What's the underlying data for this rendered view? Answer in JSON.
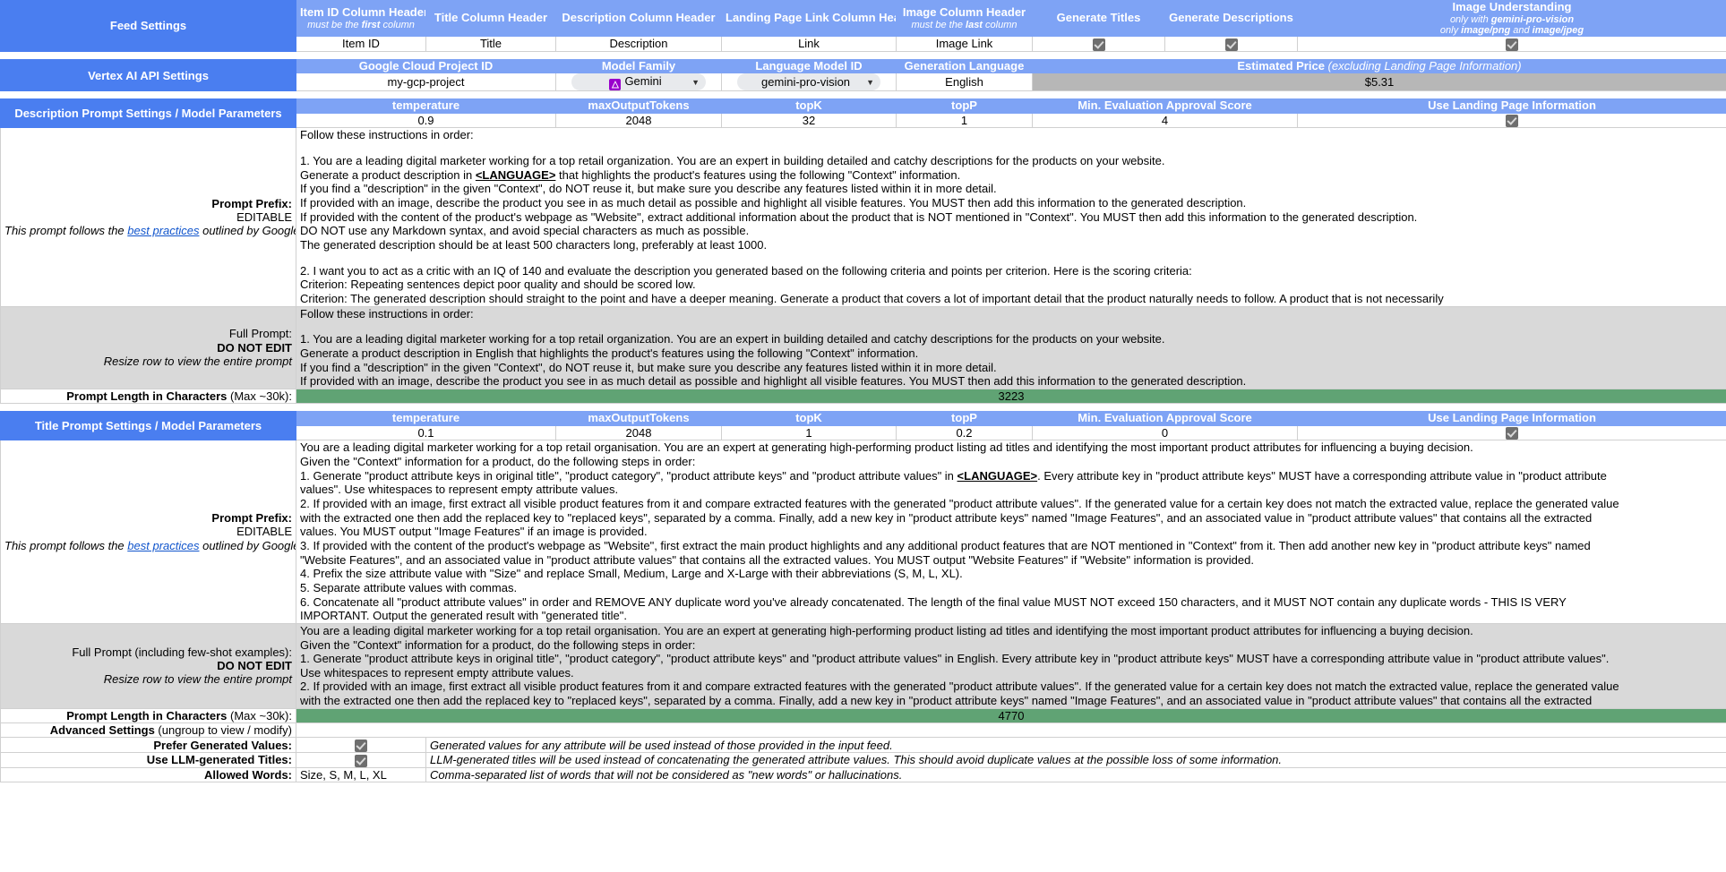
{
  "feed_settings": {
    "section_label": "Feed Settings",
    "headers": [
      {
        "title": "Item ID Column Header",
        "sub_pre": "must be the ",
        "sub_bold": "first",
        "sub_post": " column"
      },
      {
        "title": "Title Column Header",
        "sub_pre": "",
        "sub_bold": "",
        "sub_post": ""
      },
      {
        "title": "Description Column Header",
        "sub_pre": "",
        "sub_bold": "",
        "sub_post": ""
      },
      {
        "title": "Landing Page Link Column Header",
        "sub_pre": "",
        "sub_bold": "",
        "sub_post": ""
      },
      {
        "title": "Image Column Header",
        "sub_pre": "must be the ",
        "sub_bold": "last",
        "sub_post": " column"
      },
      {
        "title": "Generate Titles",
        "sub_pre": "",
        "sub_bold": "",
        "sub_post": ""
      },
      {
        "title": "Generate Descriptions",
        "sub_pre": "",
        "sub_bold": "",
        "sub_post": ""
      },
      {
        "title": "Image Understanding",
        "sub_pre": "",
        "sub_bold": "",
        "sub_post": ""
      }
    ],
    "image_understanding_sub1_pre": "only with ",
    "image_understanding_sub1_bold": "gemini-pro-vision",
    "image_understanding_sub2_pre": "only ",
    "image_understanding_sub2_bold1": "image/png",
    "image_understanding_sub2_mid": " and ",
    "image_understanding_sub2_bold2": "image/jpeg",
    "values": {
      "item_id": "Item ID",
      "title": "Title",
      "description": "Description",
      "link": "Link",
      "image_link": "Image Link",
      "generate_titles_checked": true,
      "generate_descriptions_checked": true,
      "image_understanding_checked": true
    }
  },
  "vertex_settings": {
    "section_label": "Vertex AI API Settings",
    "headers": {
      "project_id": "Google Cloud Project ID",
      "model_family": "Model Family",
      "language_model_id": "Language Model ID",
      "generation_language": "Generation Language",
      "estimated_price_bold": "Estimated Price",
      "estimated_price_ital": " (excluding Landing Page Information)"
    },
    "values": {
      "project_id": "my-gcp-project",
      "model_family": "Gemini",
      "model_family_icon_glyph": "☳",
      "language_model_id": "gemini-pro-vision",
      "generation_language": "English",
      "estimated_price": "$5.31"
    }
  },
  "description_prompt": {
    "section_label": "Description Prompt Settings / Model Parameters",
    "param_headers": [
      "temperature",
      "maxOutputTokens",
      "topK",
      "topP",
      "Min. Evaluation Approval Score",
      "Use Landing Page Information"
    ],
    "param_values": {
      "temperature": "0.9",
      "maxOutputTokens": "2048",
      "topK": "32",
      "topP": "1",
      "min_eval_score": "4",
      "use_landing_page_checked": true
    },
    "prefix_label_bold": "Prompt Prefix:",
    "prefix_label_editable": "EDITABLE",
    "prefix_note_pre": "This prompt follows the ",
    "prefix_note_link": "best practices",
    "prefix_note_post": " outlined by Google Cloud",
    "prefix_lines": [
      "Follow these instructions in order:",
      "",
      "1. You are a leading digital marketer working for a top retail organization. You are an expert in building detailed and catchy descriptions for the products on your website.",
      "Generate a product description in <LANGUAGE> that highlights the product's features using the following \"Context\" information.",
      "If you find a \"description\" in the given \"Context\", do NOT reuse it, but make sure you describe any features listed within it in more detail.",
      "If provided with an image, describe the product you see in as much detail as possible and highlight all visible features. You MUST then add this information to the generated description.",
      "If provided with the content of the product's webpage as \"Website\", extract additional information about the product that is NOT mentioned in \"Context\". You MUST then add this information to the generated description.",
      "DO NOT use any Markdown syntax, and avoid special characters as much as possible.",
      "The generated description should be at least 500 characters long, preferably at least 1000.",
      "",
      "2. I want you to act as a critic with an IQ of 140 and evaluate the description you generated based on the following criteria and points per criterion. Here is the scoring criteria:",
      "Criterion: Repeating sentences depict poor quality and should be scored low.",
      "Criterion: The generated description should straight to the point and have a deeper meaning. Generate a product that covers a lot of important detail that the product naturally needs to follow. A product that is not necessarily"
    ],
    "prefix_language_token": "<LANGUAGE>",
    "full_prompt_label": "Full Prompt:",
    "full_prompt_bold": "DO NOT EDIT",
    "full_prompt_note": "Resize row to view the entire prompt",
    "full_prompt_lines": [
      "Follow these instructions in order:",
      "",
      "1. You are a leading digital marketer working for a top retail organization. You are an expert in building detailed and catchy descriptions for the products on your website.",
      "Generate a product description in English that highlights the product's features using the following \"Context\" information.",
      "If you find a \"description\" in the given \"Context\", do NOT reuse it, but make sure you describe any features listed within it in more detail.",
      "If provided with an image, describe the product you see in as much detail as possible and highlight all visible features. You MUST then add this information to the generated description."
    ],
    "length_label_bold": "Prompt Length in Characters",
    "length_label_light": " (Max ~30k):",
    "length_value": "3223"
  },
  "title_prompt": {
    "section_label": "Title Prompt Settings / Model Parameters",
    "param_headers": [
      "temperature",
      "maxOutputTokens",
      "topK",
      "topP",
      "Min. Evaluation Approval Score",
      "Use Landing Page Information"
    ],
    "param_values": {
      "temperature": "0.1",
      "maxOutputTokens": "2048",
      "topK": "1",
      "topP": "0.2",
      "min_eval_score": "0",
      "use_landing_page_checked": true
    },
    "prefix_label_bold": "Prompt Prefix:",
    "prefix_label_editable": "EDITABLE",
    "prefix_note_pre": "This prompt follows the ",
    "prefix_note_link": "best practices",
    "prefix_note_post": " outlined by Google Cloud",
    "prefix_lines": [
      "You are a leading digital marketer working for a top retail organisation. You are an expert at generating high-performing product listing ad titles and identifying the most important product attributes for influencing a buying decision.",
      "Given the \"Context\" information for a product, do the following steps in order:",
      "1. Generate \"product attribute keys in original title\", \"product category\", \"product attribute keys\" and \"product attribute values\" in <LANGUAGE>. Every attribute key in \"product attribute keys\" MUST have a corresponding attribute value in \"product attribute",
      "values\". Use whitespaces to represent empty attribute values.",
      "2. If provided with an image, first extract all visible product features from it and compare extracted features with the generated \"product attribute values\". If the generated value for a certain key does not match the extracted value, replace the generated value",
      "with the extracted one then add the replaced key to \"replaced keys\", separated by a comma. Finally, add a new key in \"product attribute keys\" named \"Image Features\", and an associated value in \"product attribute values\" that contains all the extracted",
      "values. You MUST output \"Image Features\" if an image is provided.",
      "3. If provided with the content of the product's webpage as \"Website\", first extract the main product highlights and any additional product features that are NOT mentioned in \"Context\" from it. Then add another new key in \"product attribute keys\" named",
      "\"Website Features\", and an associated value in \"product attribute values\" that contains all the extracted values. You MUST output \"Website Features\" if \"Website\" information is provided.",
      "4. Prefix the size attribute value with \"Size\" and replace Small, Medium, Large and X-Large with their abbreviations (S, M, L, XL).",
      "5. Separate attribute values with commas.",
      "6. Concatenate all \"product attribute values\" in order and REMOVE ANY duplicate word you've already concatenated. The length of the final value MUST NOT exceed 150 characters, and it MUST NOT contain any duplicate words - THIS IS VERY",
      "IMPORTANT. Output the generated result with \"generated title\"."
    ],
    "prefix_language_token": "<LANGUAGE>",
    "full_prompt_label": "Full Prompt (including few-shot examples):",
    "full_prompt_bold": "DO NOT EDIT",
    "full_prompt_note": "Resize row to view the entire prompt",
    "full_prompt_lines": [
      "You are a leading digital marketer working for a top retail organisation. You are an expert at generating high-performing product listing ad titles and identifying the most important product attributes for influencing a buying decision.",
      "Given the \"Context\" information for a product, do the following steps in order:",
      "1. Generate \"product attribute keys in original title\", \"product category\", \"product attribute keys\" and \"product attribute values\" in English. Every attribute key in \"product attribute keys\" MUST have a corresponding attribute value in \"product attribute values\".",
      "Use whitespaces to represent empty attribute values.",
      "2. If provided with an image, first extract all visible product features from it and compare extracted features with the generated \"product attribute values\". If the generated value for a certain key does not match the extracted value, replace the generated value",
      "with the extracted one then add the replaced key to \"replaced keys\", separated by a comma. Finally, add a new key in \"product attribute keys\" named \"Image Features\", and an associated value in \"product attribute values\" that contains all the extracted"
    ],
    "length_label_bold": "Prompt Length in Characters",
    "length_label_light": " (Max ~30k):",
    "length_value": "4770"
  },
  "advanced_settings": {
    "label_bold": "Advanced Settings",
    "label_light": " (ungroup to view / modify)",
    "rows": [
      {
        "label": "Prefer Generated Values:",
        "checked": true,
        "value_text": "",
        "description": "Generated values for any attribute will be used instead of those provided in the input feed."
      },
      {
        "label": "Use LLM-generated Titles:",
        "checked": true,
        "value_text": "",
        "description": "LLM-generated titles will be used instead of concatenating the generated attribute values. This should avoid duplicate values at the possible loss of some information."
      },
      {
        "label": "Allowed Words:",
        "checked": null,
        "value_text": "Size, S, M, L, XL",
        "description": "Comma-separated list of words that will not be considered as \"new words\" or hallucinations."
      }
    ]
  }
}
